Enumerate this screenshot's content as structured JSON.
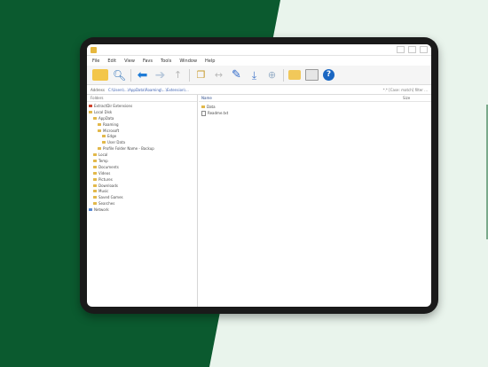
{
  "window": {
    "title": ""
  },
  "menu": [
    "File",
    "Edit",
    "View",
    "Favs",
    "Tools",
    "Window",
    "Help"
  ],
  "toolbar": {
    "icons": [
      "folder-icon",
      "search-icon",
      "back-arrow-icon",
      "forward-arrow-icon",
      "up-icon",
      "copy-icon",
      "move-icon",
      "pen-icon",
      "download-icon",
      "add-icon",
      "folder-icon",
      "panel-icon",
      "help-icon"
    ]
  },
  "address": {
    "label": "Address",
    "path": "C:\\Users\\...\\AppData\\Roaming\\...\\Extension\\...",
    "filter": "*.* [Case: match] filter ..."
  },
  "tree": {
    "header": "Folders",
    "items": [
      {
        "label": "ExtractDir Extensions",
        "icon": "red",
        "indent": 0
      },
      {
        "label": "Local Disk",
        "icon": "yellow",
        "indent": 0
      },
      {
        "label": "AppData",
        "icon": "yellow",
        "indent": 1
      },
      {
        "label": "Roaming",
        "icon": "yellow",
        "indent": 2
      },
      {
        "label": "Microsoft",
        "icon": "yellow",
        "indent": 2
      },
      {
        "label": "Edge",
        "icon": "yellow",
        "indent": 3
      },
      {
        "label": "User Data",
        "icon": "yellow",
        "indent": 3
      },
      {
        "label": "Profile Folder Name - Backup",
        "icon": "yellow",
        "indent": 2
      },
      {
        "label": "Local",
        "icon": "yellow",
        "indent": 1
      },
      {
        "label": "Temp",
        "icon": "yellow",
        "indent": 1
      },
      {
        "label": "Documents",
        "icon": "yellow",
        "indent": 1
      },
      {
        "label": "Videos",
        "icon": "yellow",
        "indent": 1
      },
      {
        "label": "Pictures",
        "icon": "yellow",
        "indent": 1
      },
      {
        "label": "Downloads",
        "icon": "yellow",
        "indent": 1
      },
      {
        "label": "Music",
        "icon": "yellow",
        "indent": 1
      },
      {
        "label": "Saved Games",
        "icon": "yellow",
        "indent": 1
      },
      {
        "label": "Searches",
        "icon": "yellow",
        "indent": 1
      },
      {
        "label": "Network",
        "icon": "blue",
        "indent": 0
      }
    ]
  },
  "list": {
    "col_name": "Name",
    "col_size": "Size",
    "files": [
      {
        "name": "Data",
        "type": "folder"
      },
      {
        "name": "Readme.txt",
        "type": "doc"
      }
    ]
  }
}
